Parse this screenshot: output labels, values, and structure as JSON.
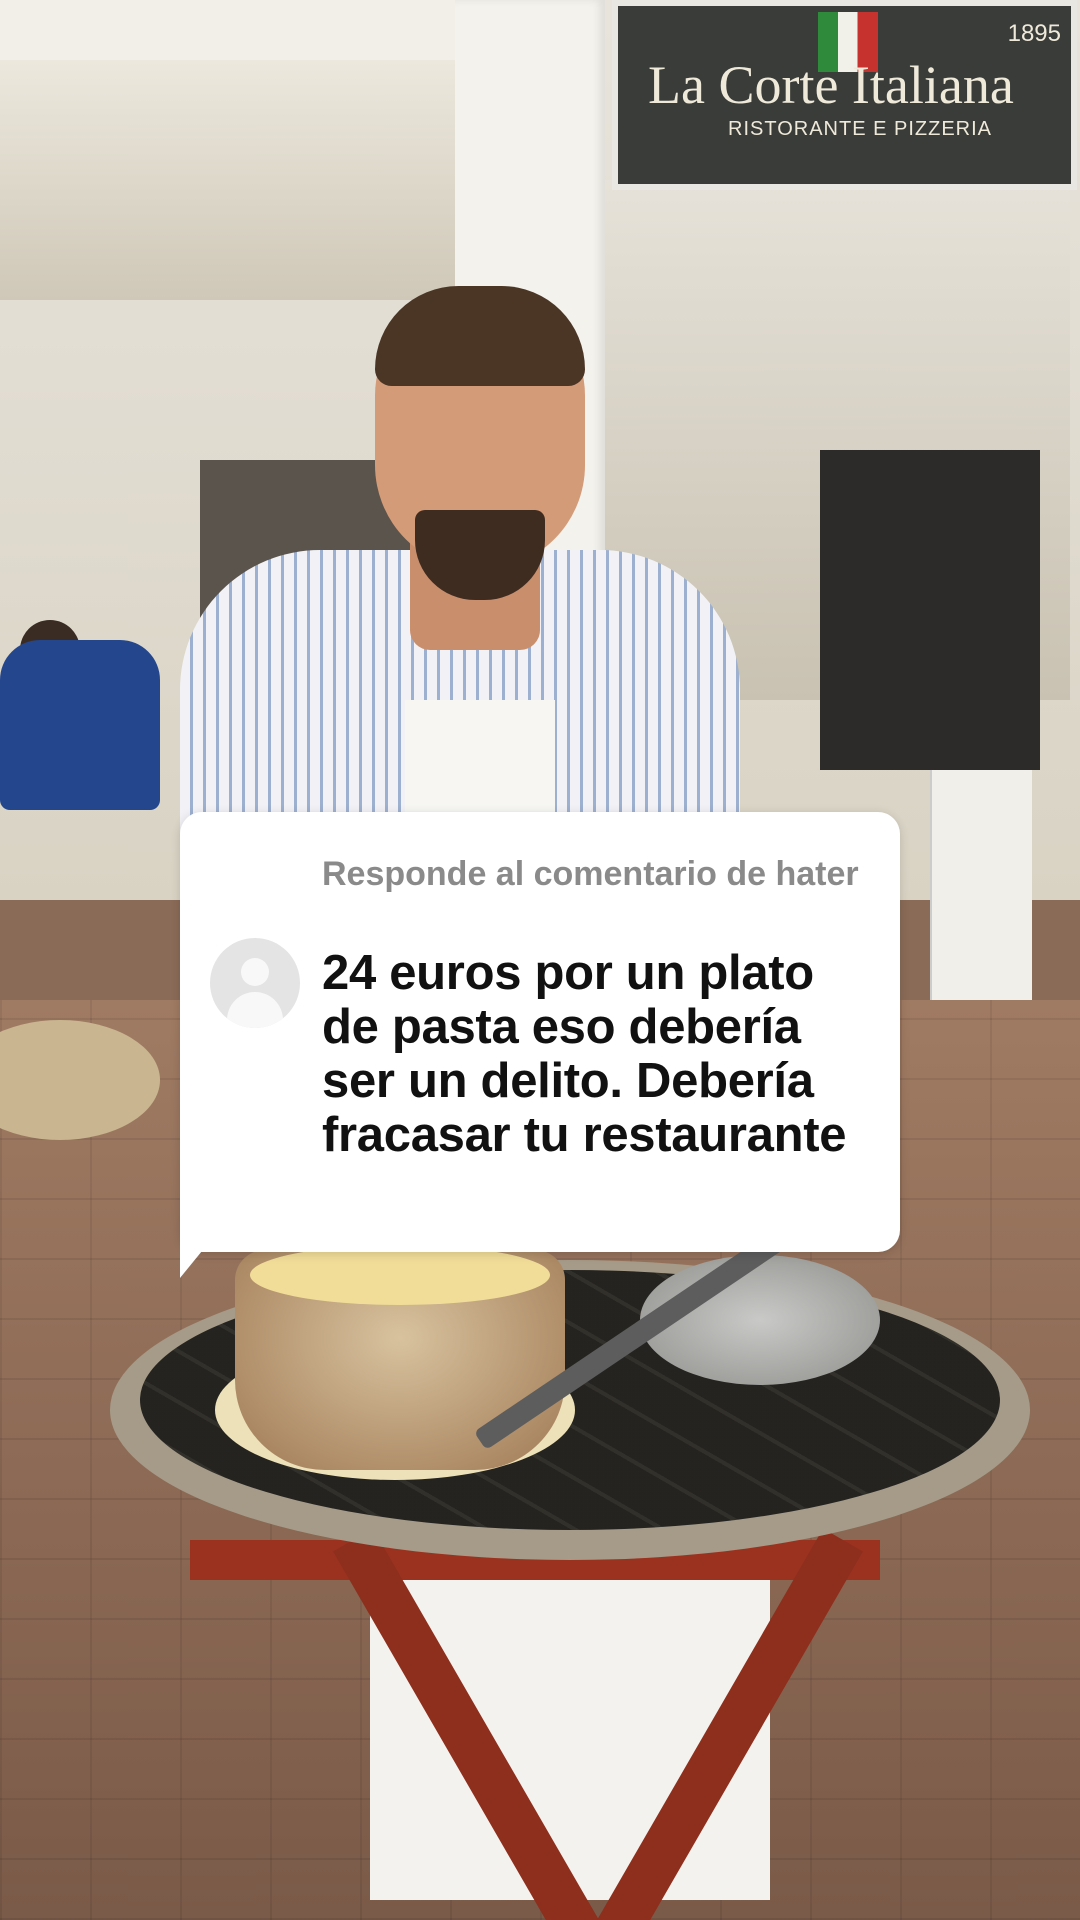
{
  "sign": {
    "title": "La Corte Italiana",
    "subtitle": "RISTORANTE E PIZZERIA",
    "number": "1895"
  },
  "comment": {
    "reply_label": "Responde al comentario de hater",
    "text": "24 euros por un plato de pasta eso debería ser un delito. Debería fracasar tu restaurante"
  },
  "icons": {
    "avatar": "default-user-avatar-icon"
  },
  "colors": {
    "card_background": "#ffffff",
    "reply_label": "#8a8a8a",
    "comment_text": "#111111"
  }
}
